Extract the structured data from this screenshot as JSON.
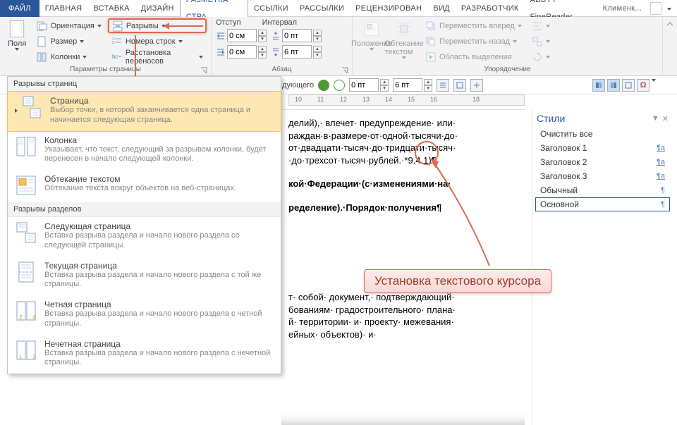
{
  "tabs": {
    "file": "ФАЙЛ",
    "items": [
      "ГЛАВНАЯ",
      "ВСТАВКА",
      "ДИЗАЙН",
      "РАЗМЕТКА СТРА",
      "ССЫЛКИ",
      "РАССЫЛКИ",
      "РЕЦЕНЗИРОВАН",
      "ВИД",
      "РАЗРАБОТЧИК",
      "ABBYY FineReader"
    ],
    "user": "Клименк..."
  },
  "ribbon": {
    "page_setup": {
      "fields": "Поля",
      "orientation": "Ориентация",
      "size": "Размер",
      "columns": "Колонки",
      "breaks": "Разрывы",
      "line_numbers": "Номера строк",
      "hyphenation": "Расстановка переносов",
      "label": "Параметры страницы"
    },
    "paragraph": {
      "indent_label": "Отступ",
      "spacing_label": "Интервал",
      "left": "0 см",
      "right": "0 см",
      "before": "0 пт",
      "after": "6 пт",
      "label": "Абзац"
    },
    "arrange": {
      "position": "Положение",
      "wrap": "Обтекание текстом",
      "forward": "Переместить вперед",
      "backward": "Переместить назад",
      "selection": "Область выделения",
      "label": "Упорядочение"
    }
  },
  "toolbar2": {
    "spacing_before": "0 пт",
    "spacing_after": "6 пт"
  },
  "ruler": [
    "10",
    "11",
    "12",
    "13",
    "14",
    "15",
    "16",
    "",
    "18"
  ],
  "doc_lines": [
    "делий),· влечет· предупреждение· или·",
    "раждан·в·размере·от·одной·тысячи·до·",
    "от·двадцати·тысяч·до·тридцати·тысяч·",
    "·до·трехсот·тысяч·рублей.·*9.4.1)¶",
    "",
    "кой·Федерации·(с·изменениями·на·",
    "",
    "ределение).·Порядок·получения¶",
    "",
    "т· собой· документ,· подтверждающий·",
    "бованиям· градостроительного· плана·",
    "й· территории· и· проекту· межевания·",
    "ейных· объектов)· и·"
  ],
  "doc_bold": [
    false,
    false,
    false,
    false,
    false,
    true,
    false,
    true,
    false,
    false,
    false,
    false,
    false
  ],
  "styles": {
    "title": "Стили",
    "clear": "Очистить все",
    "items": [
      "Заголовок 1",
      "Заголовок 2",
      "Заголовок 3",
      "Обычный",
      "Основной"
    ],
    "selected": 4
  },
  "gallery": {
    "h1": "Разрывы страниц",
    "h2": "Разрывы разделов",
    "page_breaks": [
      {
        "t": "Страница",
        "d": "Выбор точки, в которой заканчивается одна страница и начинается следующая страница."
      },
      {
        "t": "Колонка",
        "d": "Указывает, что текст, следующий за разрывом колонки, будет перенесен в начало следующей колонки."
      },
      {
        "t": "Обтекание текстом",
        "d": "Обтекание текста вокруг объектов на веб-страницах."
      }
    ],
    "section_breaks": [
      {
        "t": "Следующая страница",
        "d": "Вставка разрыва раздела и начало нового раздела со следующей страницы."
      },
      {
        "t": "Текущая страница",
        "d": "Вставка разрыва раздела и начало нового раздела с той же страницы."
      },
      {
        "t": "Четная страница",
        "d": "Вставка разрыва раздела и начало нового раздела с четной страницы."
      },
      {
        "t": "Нечетная страница",
        "d": "Вставка разрыва раздела и начало нового раздела с нечетной страницы."
      }
    ]
  },
  "annotation": "Установка текстового курсора"
}
